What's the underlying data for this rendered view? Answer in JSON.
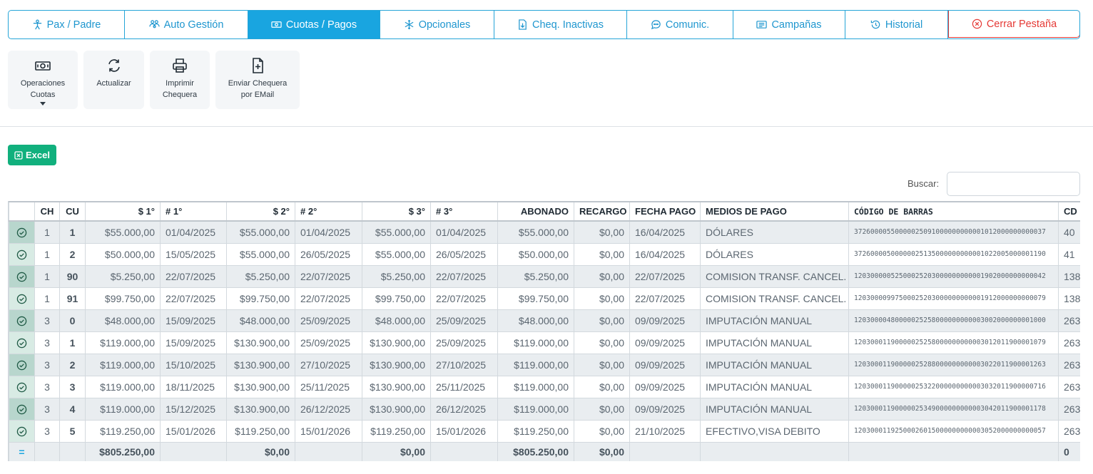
{
  "tabs": [
    {
      "label": "Pax / Padre",
      "icon": "person-icon"
    },
    {
      "label": "Auto Gestión",
      "icon": "group-icon"
    },
    {
      "label": "Cuotas / Pagos",
      "icon": "money-icon",
      "active": true
    },
    {
      "label": "Opcionales",
      "icon": "snowflake-icon"
    },
    {
      "label": "Cheq. Inactivas",
      "icon": "file-download-icon"
    },
    {
      "label": "Comunic.",
      "icon": "chat-icon"
    },
    {
      "label": "Campañas",
      "icon": "newspaper-icon"
    },
    {
      "label": "Historial",
      "icon": "history-icon"
    },
    {
      "label": "Cerrar Pestaña",
      "icon": "close-circle-icon",
      "danger": true
    }
  ],
  "actions": {
    "operaciones_line1": "Operaciones",
    "operaciones_line2": "Cuotas",
    "actualizar": "Actualizar",
    "imprimir_line1": "Imprimir",
    "imprimir_line2": "Chequera",
    "enviar_line1": "Enviar Chequera",
    "enviar_line2": "por EMail"
  },
  "excel_label": "Excel",
  "search_label": "Buscar:",
  "search_value": "",
  "colors": {
    "accent": "#19a5e0",
    "danger": "#e53935",
    "excel": "#11b07d"
  },
  "table": {
    "headers": [
      "CH",
      "CU",
      "$ 1°",
      "# 1°",
      "$ 2°",
      "# 2°",
      "$ 3°",
      "# 3°",
      "ABONADO",
      "RECARGO",
      "FECHA PAGO",
      "MEDIOS DE PAGO",
      "CÓDIGO DE BARRAS",
      "CD B"
    ],
    "rows": [
      [
        "1",
        "1",
        "$55.000,00",
        "01/04/2025",
        "$55.000,00",
        "01/04/2025",
        "$55.000,00",
        "01/04/2025",
        "$55.000,00",
        "$0,00",
        "16/04/2025",
        "DÓLARES",
        "37260000550000025091000000000001012000000000037",
        "40"
      ],
      [
        "1",
        "2",
        "$50.000,00",
        "15/05/2025",
        "$55.000,00",
        "26/05/2025",
        "$55.000,00",
        "26/05/2025",
        "$50.000,00",
        "$0,00",
        "16/04/2025",
        "DÓLARES",
        "37260000500000025135000000000001022005000001190",
        "41"
      ],
      [
        "1",
        "90",
        "$5.250,00",
        "22/07/2025",
        "$5.250,00",
        "22/07/2025",
        "$5.250,00",
        "22/07/2025",
        "$5.250,00",
        "$0,00",
        "22/07/2025",
        "COMISION TRANSF. CANCEL.",
        "12030000052500025203000000000001902000000000042",
        "138"
      ],
      [
        "1",
        "91",
        "$99.750,00",
        "22/07/2025",
        "$99.750,00",
        "22/07/2025",
        "$99.750,00",
        "22/07/2025",
        "$99.750,00",
        "$0,00",
        "22/07/2025",
        "COMISION TRANSF. CANCEL.",
        "12030000997500025203000000000001912000000000079",
        "138"
      ],
      [
        "3",
        "0",
        "$48.000,00",
        "15/09/2025",
        "$48.000,00",
        "25/09/2025",
        "$48.000,00",
        "25/09/2025",
        "$48.000,00",
        "$0,00",
        "09/09/2025",
        "IMPUTACIÓN MANUAL",
        "12030000480000025258000000000003002000000001000",
        "263"
      ],
      [
        "3",
        "1",
        "$119.000,00",
        "15/09/2025",
        "$130.900,00",
        "25/09/2025",
        "$130.900,00",
        "25/09/2025",
        "$119.000,00",
        "$0,00",
        "09/09/2025",
        "IMPUTACIÓN MANUAL",
        "12030001190000025258000000000003012011900001079",
        "263"
      ],
      [
        "3",
        "2",
        "$119.000,00",
        "15/10/2025",
        "$130.900,00",
        "27/10/2025",
        "$130.900,00",
        "27/10/2025",
        "$119.000,00",
        "$0,00",
        "09/09/2025",
        "IMPUTACIÓN MANUAL",
        "12030001190000025288000000000003022011900001263",
        "263"
      ],
      [
        "3",
        "3",
        "$119.000,00",
        "18/11/2025",
        "$130.900,00",
        "25/11/2025",
        "$130.900,00",
        "25/11/2025",
        "$119.000,00",
        "$0,00",
        "09/09/2025",
        "IMPUTACIÓN MANUAL",
        "12030001190000025322000000000003032011900000716",
        "263"
      ],
      [
        "3",
        "4",
        "$119.000,00",
        "15/12/2025",
        "$130.900,00",
        "26/12/2025",
        "$130.900,00",
        "26/12/2025",
        "$119.000,00",
        "$0,00",
        "09/09/2025",
        "IMPUTACIÓN MANUAL",
        "12030001190000025349000000000003042011900001178",
        "263"
      ],
      [
        "3",
        "5",
        "$119.250,00",
        "15/01/2026",
        "$119.250,00",
        "15/01/2026",
        "$119.250,00",
        "15/01/2026",
        "$119.250,00",
        "$0,00",
        "21/10/2025",
        "EFECTIVO,VISA DEBITO",
        "12030001192500026015000000000003052000000000057",
        "263"
      ]
    ],
    "totals": [
      "",
      "",
      "$805.250,00",
      "",
      "$0,00",
      "",
      "$0,00",
      "",
      "$805.250,00",
      "$0,00",
      "",
      "",
      "",
      "0"
    ]
  }
}
